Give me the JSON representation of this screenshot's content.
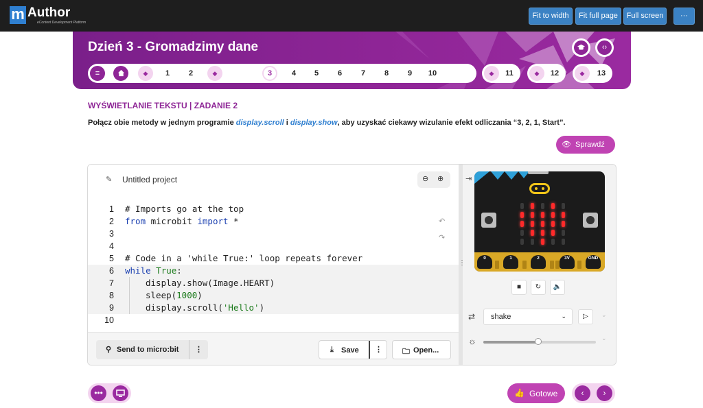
{
  "topbar": {
    "logo_m": "m",
    "logo_author": "Author",
    "logo_sub": "eContent Development Platform",
    "buttons": [
      "Fit to width",
      "Fit full page",
      "Full screen",
      "···"
    ]
  },
  "banner": {
    "title": "Dzień 3 - Gromadzimy dane",
    "nav_pages": [
      "1",
      "2",
      "3",
      "4",
      "5",
      "6",
      "7",
      "8",
      "9",
      "10",
      "11",
      "12",
      "13"
    ],
    "current_page": "3"
  },
  "task": {
    "section_title": "WYŚWIETLANIE TEKSTU | ZADANIE 2",
    "instruction_1": "Połącz obie metody w jednym programie ",
    "code_1": "display.scroll",
    "instruction_2": " i ",
    "code_2": "display.show",
    "instruction_3": ", aby uzyskać ciekawy wizulanie efekt odliczania “3, 2, 1, Start”.",
    "check_label": "Sprawdź"
  },
  "editor": {
    "project_title": "Untitled project",
    "line_numbers": [
      "1",
      "2",
      "3",
      "4",
      "5",
      "6",
      "7",
      "8",
      "9",
      "10"
    ],
    "code": {
      "l1": "# Imports go at the top",
      "l2_kw": "from",
      "l2_mid": " microbit ",
      "l2_kw2": "import",
      "l2_end": " *",
      "l5": "# Code in a 'while True:' loop repeats forever",
      "l6_kw": "while",
      "l6_true": "True",
      "l6_end": ":",
      "l7": "display.show(Image.HEART)",
      "l8_a": "sleep(",
      "l8_num": "1000",
      "l8_b": ")",
      "l9_a": "display.scroll(",
      "l9_str": "'Hello'",
      "l9_b": ")"
    },
    "send_label": "Send to micro:bit",
    "save_label": "Save",
    "open_label": "Open...",
    "more_label": "⋮"
  },
  "simulator": {
    "pins": [
      "0",
      "1",
      "2",
      "3V",
      "GND"
    ],
    "gesture_value": "shake",
    "led_matrix": [
      [
        0,
        1,
        0,
        1,
        0
      ],
      [
        1,
        1,
        1,
        1,
        1
      ],
      [
        1,
        1,
        1,
        1,
        1
      ],
      [
        0,
        1,
        1,
        1,
        0
      ],
      [
        0,
        0,
        1,
        0,
        0
      ]
    ],
    "light_level": 0.49
  },
  "footer": {
    "ready_label": "Gotowe"
  },
  "colors": {
    "brand_purple": "#8e2596",
    "accent_pink": "#c043b3",
    "light_pink": "#f3d4ef",
    "topbar_button": "#3b82c4",
    "led_on": "#ff2a2a"
  }
}
